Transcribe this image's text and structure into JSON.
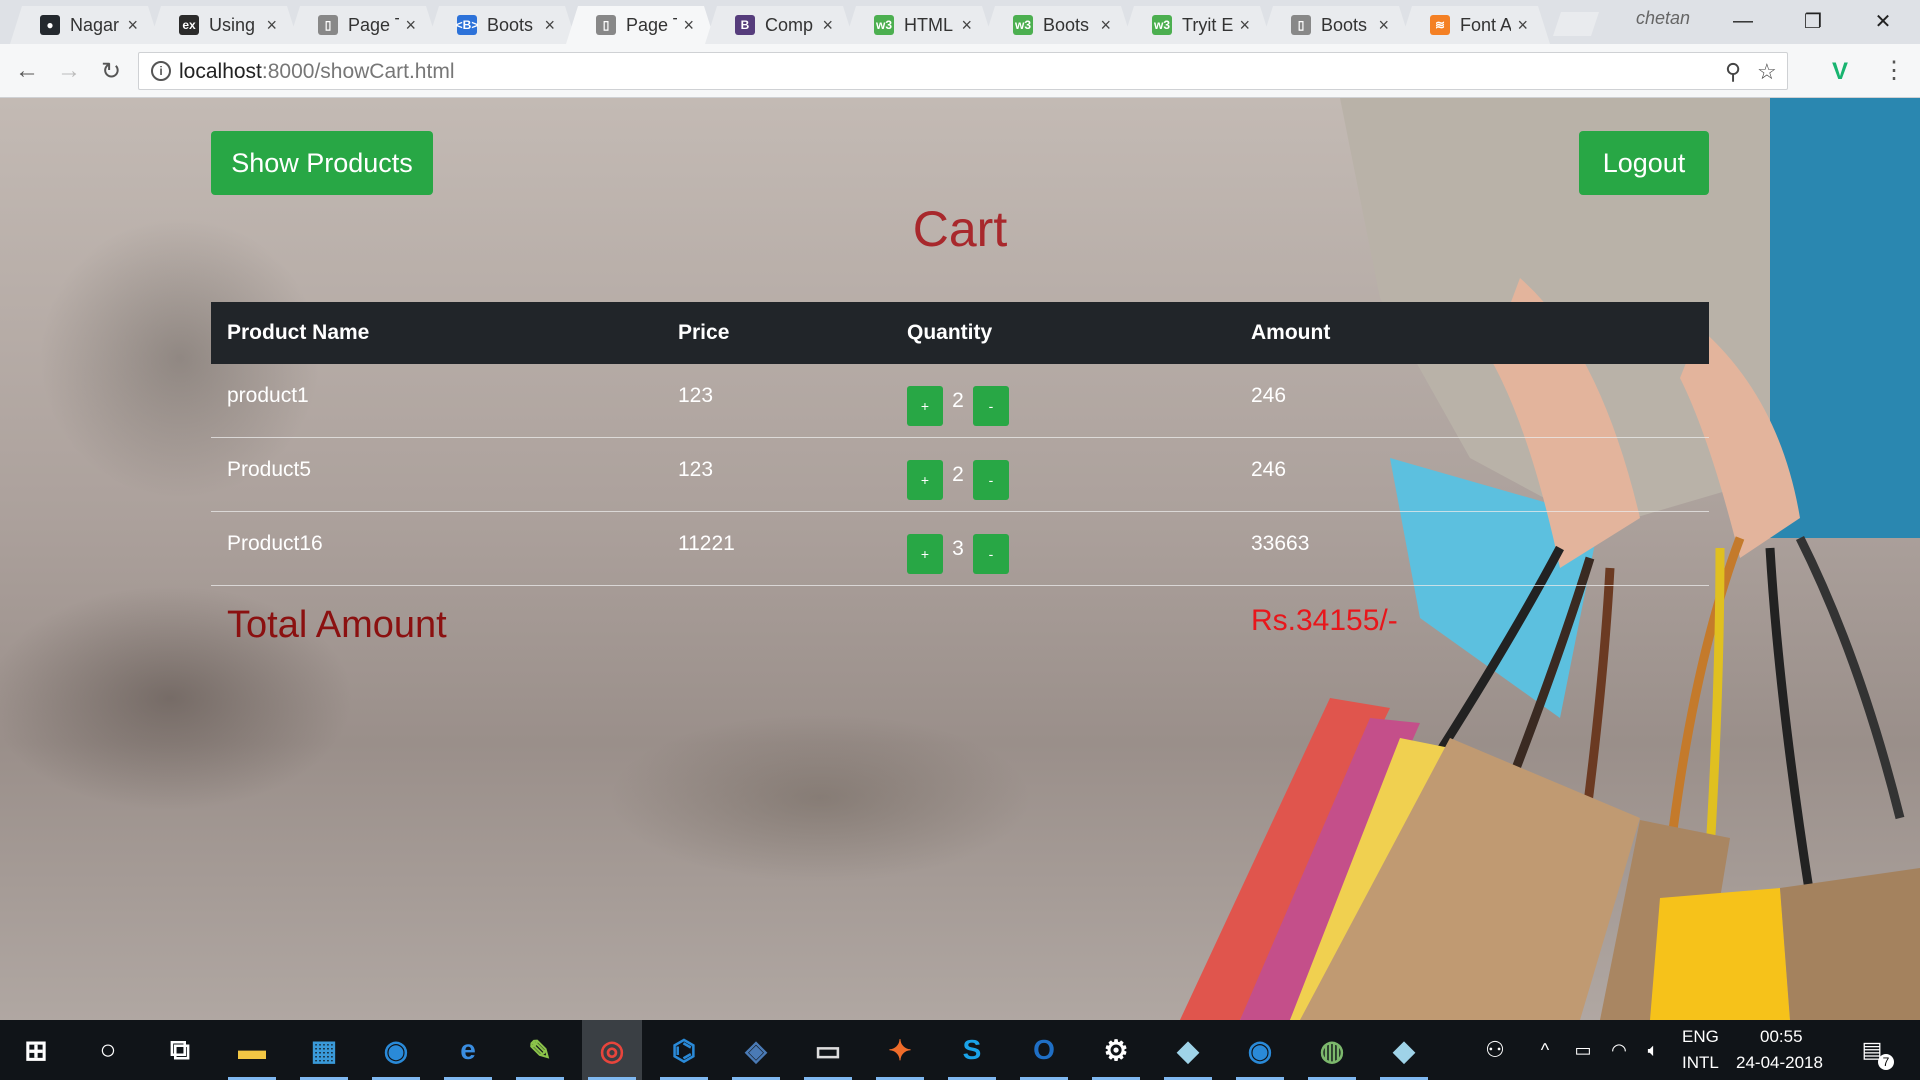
{
  "browser": {
    "tabs": [
      {
        "label": "Nagar",
        "icon": "github-icon",
        "color": "#24292e",
        "glyph": "●"
      },
      {
        "label": "Using",
        "icon": "experts-exchange-icon",
        "color": "#2b2b2b",
        "glyph": "ex"
      },
      {
        "label": "Page T",
        "icon": "page-icon",
        "color": "#888888",
        "glyph": "▯"
      },
      {
        "label": "Boots",
        "icon": "bootstrap-icon",
        "color": "#2d72d9",
        "glyph": "<B>"
      },
      {
        "label": "Page T",
        "icon": "page-icon",
        "color": "#888888",
        "glyph": "▯",
        "active": true
      },
      {
        "label": "Comp",
        "icon": "bootstrap-b-icon",
        "color": "#563d7c",
        "glyph": "B"
      },
      {
        "label": "HTML",
        "icon": "w3schools-icon",
        "color": "#4caf50",
        "glyph": "w3"
      },
      {
        "label": "Boots",
        "icon": "w3schools-icon",
        "color": "#4caf50",
        "glyph": "w3"
      },
      {
        "label": "Tryit E",
        "icon": "w3schools-icon",
        "color": "#4caf50",
        "glyph": "w3"
      },
      {
        "label": "Boots",
        "icon": "page-icon",
        "color": "#888888",
        "glyph": "▯"
      },
      {
        "label": "Font A",
        "icon": "stackoverflow-icon",
        "color": "#f48024",
        "glyph": "≋"
      }
    ],
    "profile_name": "chetan",
    "url_host": "localhost",
    "url_rest": ":8000/showCart.html"
  },
  "page": {
    "show_products_label": "Show Products",
    "logout_label": "Logout",
    "title": "Cart",
    "columns": [
      "Product Name",
      "Price",
      "Quantity",
      "Amount"
    ],
    "rows": [
      {
        "name": "product1",
        "price": "123",
        "qty": "2",
        "amount": "246"
      },
      {
        "name": "Product5",
        "price": "123",
        "qty": "2",
        "amount": "246"
      },
      {
        "name": "Product16",
        "price": "11221",
        "qty": "3",
        "amount": "33663"
      }
    ],
    "plus_label": "+",
    "minus_label": "-",
    "total_label": "Total Amount",
    "total_value": "Rs.34155/-"
  },
  "taskbar": {
    "lang_top": "ENG",
    "lang_bottom": "INTL",
    "time": "00:55",
    "date": "24-04-2018",
    "notification_count": "7",
    "apps": [
      {
        "name": "start-icon"
      },
      {
        "name": "cortana-icon"
      },
      {
        "name": "task-view-icon"
      },
      {
        "name": "file-explorer-icon"
      },
      {
        "name": "store-icon"
      },
      {
        "name": "app-blue-icon"
      },
      {
        "name": "edge-icon"
      },
      {
        "name": "notepad-plus-icon"
      },
      {
        "name": "chrome-icon",
        "active": true
      },
      {
        "name": "vscode-icon"
      },
      {
        "name": "mysql-icon"
      },
      {
        "name": "terminal-icon"
      },
      {
        "name": "postman-icon"
      },
      {
        "name": "skype-icon"
      },
      {
        "name": "outlook-icon"
      },
      {
        "name": "settings-icon"
      },
      {
        "name": "app-book-icon"
      },
      {
        "name": "app-blue2-icon"
      },
      {
        "name": "globe-icon"
      },
      {
        "name": "app-book2-icon"
      }
    ]
  },
  "colors": {
    "button_green": "#28a745",
    "title_red": "#a8282c",
    "total_red": "#8b1010",
    "amount_red": "#e8161b",
    "table_header": "#212529"
  }
}
